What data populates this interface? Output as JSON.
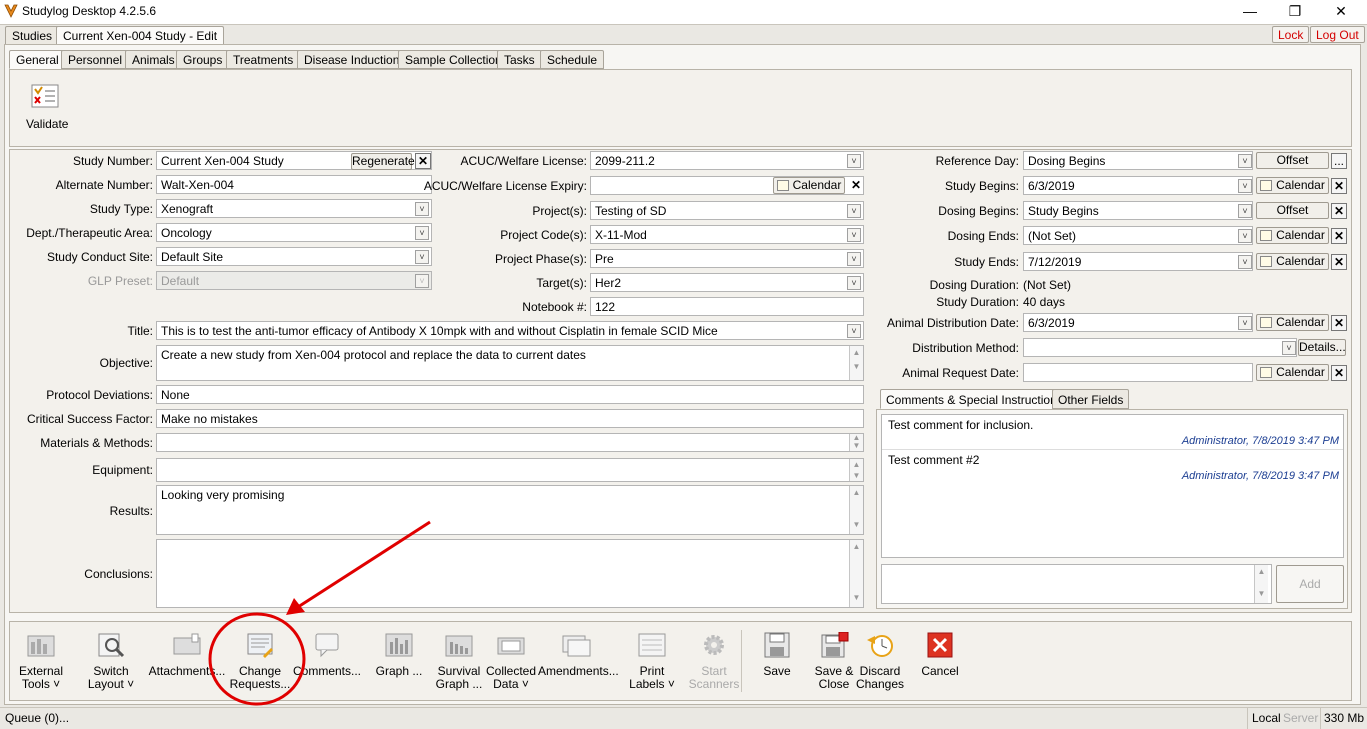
{
  "window": {
    "title": "Studylog Desktop 4.2.5.6",
    "minimize": "—",
    "maximize": "❐",
    "close": "✕"
  },
  "top_tabs": [
    "Studies",
    "Current Xen-004  Study  - Edit"
  ],
  "lock_label": "Lock",
  "logout_label": "Log Out",
  "sub_tabs": [
    "General",
    "Personnel",
    "Animals",
    "Groups",
    "Treatments",
    "Disease Induction",
    "Sample Collection",
    "Tasks",
    "Schedule"
  ],
  "validate_label": "Validate",
  "form": {
    "study_number": {
      "label": "Study Number:",
      "value": "Current Xen-004  Study",
      "button": "Regenerate"
    },
    "alternate_number": {
      "label": "Alternate Number:",
      "value": "Walt-Xen-004"
    },
    "study_type": {
      "label": "Study Type:",
      "value": "Xenograft"
    },
    "dept_area": {
      "label": "Dept./Therapeutic Area:",
      "value": "Oncology"
    },
    "conduct_site": {
      "label": "Study Conduct Site:",
      "value": "Default Site"
    },
    "glp_preset": {
      "label": "GLP Preset:",
      "value": "Default"
    },
    "acuc_license": {
      "label": "ACUC/Welfare License:",
      "value": "2099-211.2"
    },
    "acuc_expiry": {
      "label": "ACUC/Welfare License Expiry:",
      "value": ""
    },
    "projects": {
      "label": "Project(s):",
      "value": "Testing of SD"
    },
    "project_codes": {
      "label": "Project Code(s):",
      "value": "X-11-Mod"
    },
    "project_phases": {
      "label": "Project Phase(s):",
      "value": "Pre"
    },
    "targets": {
      "label": "Target(s):",
      "value": "Her2"
    },
    "notebook": {
      "label": "Notebook #:",
      "value": "122"
    },
    "title": {
      "label": "Title:",
      "value": "This is to test the anti-tumor efficacy of Antibody X 10mpk with and without Cisplatin in female SCID Mice"
    },
    "objective": {
      "label": "Objective:",
      "value": "Create a new study from  Xen-004 protocol and replace the data to current dates"
    },
    "protocol_deviations": {
      "label": "Protocol Deviations:",
      "value": "None"
    },
    "critical_success": {
      "label": "Critical Success Factor:",
      "value": "Make no mistakes"
    },
    "materials_methods": {
      "label": "Materials & Methods:",
      "value": ""
    },
    "equipment": {
      "label": "Equipment:",
      "value": ""
    },
    "results": {
      "label": "Results:",
      "value": "Looking very promising"
    },
    "conclusions": {
      "label": "Conclusions:",
      "value": ""
    }
  },
  "calendar_label": "Calendar",
  "offset_label": "Offset",
  "details_label": "Details...",
  "ellipsis_label": "...",
  "right": {
    "reference_day": {
      "label": "Reference Day:",
      "value": "Dosing Begins"
    },
    "study_begins": {
      "label": "Study Begins:",
      "value": "6/3/2019"
    },
    "dosing_begins": {
      "label": "Dosing Begins:",
      "value": "Study Begins"
    },
    "dosing_ends": {
      "label": "Dosing Ends:",
      "value": "(Not Set)"
    },
    "study_ends": {
      "label": "Study Ends:",
      "value": "7/12/2019"
    },
    "dosing_duration": {
      "label": "Dosing Duration:",
      "value": "(Not Set)"
    },
    "study_duration": {
      "label": "Study Duration:",
      "value": "40 days"
    },
    "animal_distribution_date": {
      "label": "Animal Distribution Date:",
      "value": "6/3/2019"
    },
    "distribution_method": {
      "label": "Distribution Method:",
      "value": ""
    },
    "animal_request_date": {
      "label": "Animal Request Date:",
      "value": ""
    }
  },
  "comment_tabs": [
    "Comments & Special Instructions",
    "Other Fields"
  ],
  "comments": [
    {
      "text": "Test comment for inclusion.",
      "author": "Administrator, 7/8/2019 3:47 PM"
    },
    {
      "text": "Test comment #2",
      "author": "Administrator, 7/8/2019 3:47 PM"
    }
  ],
  "add_label": "Add",
  "bottom_toolbar": [
    {
      "line1": "External",
      "line2": "Tools ˅",
      "icon": "external-tools-icon"
    },
    {
      "line1": "Switch",
      "line2": "Layout ˅",
      "icon": "switch-layout-icon"
    },
    {
      "line1": "Attachments...",
      "line2": "",
      "icon": "attachments-icon"
    },
    {
      "line1": "Change",
      "line2": "Requests...",
      "icon": "change-requests-icon"
    },
    {
      "line1": "Comments...",
      "line2": "",
      "icon": "comments-icon"
    },
    {
      "line1": "Graph ...",
      "line2": "",
      "icon": "graph-icon"
    },
    {
      "line1": "Survival",
      "line2": "Graph ...",
      "icon": "survival-graph-icon"
    },
    {
      "line1": "Collected",
      "line2": "Data ˅",
      "icon": "collected-data-icon"
    },
    {
      "line1": "Amendments...",
      "line2": "",
      "icon": "amendments-icon"
    },
    {
      "line1": "Print",
      "line2": "Labels ˅",
      "icon": "print-labels-icon"
    },
    {
      "line1": "Start",
      "line2": "Scanners",
      "icon": "start-scanners-icon"
    },
    {
      "line1": "Save",
      "line2": "",
      "icon": "save-icon"
    },
    {
      "line1": "Save &",
      "line2": "Close",
      "icon": "save-close-icon"
    },
    {
      "line1": "Discard",
      "line2": "Changes",
      "icon": "discard-changes-icon"
    },
    {
      "line1": "Cancel",
      "line2": "",
      "icon": "cancel-icon"
    }
  ],
  "status": {
    "queue": "Queue (0)...",
    "local": "Local",
    "server": "Server",
    "memory": "330 Mb"
  },
  "colors": {
    "annotation_red": "#e00000",
    "author_blue": "#1c3e92",
    "lock_red": "#d40000"
  }
}
